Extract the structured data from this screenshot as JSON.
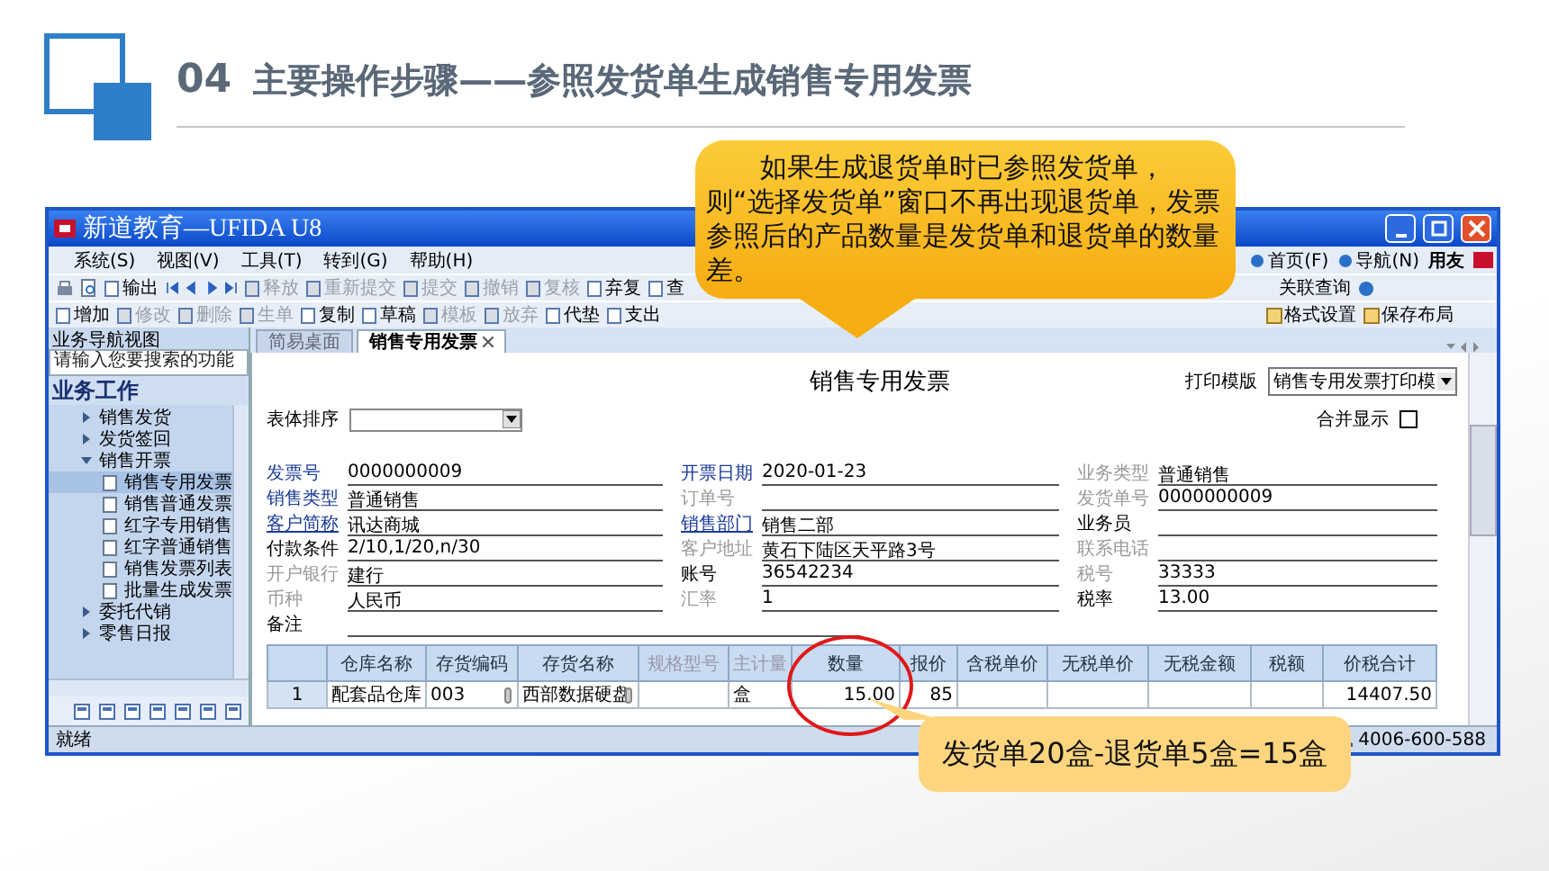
{
  "slide": {
    "section": "04",
    "title": "主要操作步骤——参照发货单生成销售专用发票"
  },
  "window": {
    "title": "新道教育—UFIDA U8",
    "menu": [
      "系统(S)",
      "视图(V)",
      "工具(T)",
      "转到(G)",
      "帮助(H)"
    ],
    "right_links": [
      "首页(F)",
      "导航(N)"
    ],
    "brand": "用友"
  },
  "toolbar_1": [
    {
      "label": "输出",
      "disabled": false
    },
    {
      "label": "释放",
      "disabled": true
    },
    {
      "label": "重新提交",
      "disabled": true
    },
    {
      "label": "提交",
      "disabled": true
    },
    {
      "label": "撤销",
      "disabled": true
    },
    {
      "label": "复核",
      "disabled": true
    },
    {
      "label": "弃复",
      "disabled": false
    },
    {
      "label": "查",
      "disabled": false
    }
  ],
  "toolbar_1_right": [
    {
      "label": "关联查询",
      "disabled": false
    }
  ],
  "toolbar_2": [
    {
      "label": "增加",
      "disabled": false
    },
    {
      "label": "修改",
      "disabled": true
    },
    {
      "label": "删除",
      "disabled": true
    },
    {
      "label": "生单",
      "disabled": true
    },
    {
      "label": "复制",
      "disabled": false
    },
    {
      "label": "草稿",
      "disabled": false
    },
    {
      "label": "模板",
      "disabled": true
    },
    {
      "label": "放弃",
      "disabled": true
    },
    {
      "label": "代垫",
      "disabled": false
    },
    {
      "label": "支出",
      "disabled": false
    }
  ],
  "toolbar_2_right": [
    {
      "label": "格式设置",
      "disabled": false
    },
    {
      "label": "保存布局",
      "disabled": false
    }
  ],
  "sidebar": {
    "title": "业务导航视图",
    "search_placeholder": "请输入您要搜索的功能",
    "section": "业务工作",
    "items": [
      {
        "label": "销售发货",
        "expanded": false,
        "selected": false
      },
      {
        "label": "发货签回",
        "expanded": false,
        "selected": false
      },
      {
        "label": "销售开票",
        "expanded": true,
        "selected": false,
        "children": [
          {
            "label": "销售专用发票",
            "selected": true
          },
          {
            "label": "销售普通发票",
            "selected": false
          },
          {
            "label": "红字专用销售",
            "selected": false
          },
          {
            "label": "红字普通销售",
            "selected": false
          },
          {
            "label": "销售发票列表",
            "selected": false
          },
          {
            "label": "批量生成发票",
            "selected": false
          }
        ]
      },
      {
        "label": "委托代销",
        "expanded": false,
        "selected": false
      },
      {
        "label": "零售日报",
        "expanded": false,
        "selected": false
      }
    ]
  },
  "tabs": [
    {
      "label": "简易桌面",
      "selected": false
    },
    {
      "label": "销售专用发票",
      "selected": true
    }
  ],
  "form": {
    "title": "销售专用发票",
    "print_template": {
      "label": "打印模版",
      "value": "销售专用发票打印模"
    },
    "merge_display": {
      "label": "合并显示",
      "checked": false
    },
    "sort": {
      "label": "表体排序"
    },
    "fields": [
      [
        {
          "label": "发票号",
          "kind": "required",
          "value": "0000000009"
        },
        {
          "label": "销售类型",
          "kind": "required",
          "value": "普通销售"
        },
        {
          "label": "客户简称",
          "kind": "link",
          "value": "讯达商城"
        },
        {
          "label": "付款条件",
          "kind": "normal",
          "value": "2/10,1/20,n/30"
        },
        {
          "label": "开户银行",
          "kind": "disabled",
          "value": "建行"
        },
        {
          "label": "币种",
          "kind": "disabled",
          "value": "人民币"
        }
      ],
      [
        {
          "label": "开票日期",
          "kind": "required",
          "value": "2020-01-23"
        },
        {
          "label": "订单号",
          "kind": "disabled"
        },
        {
          "label": "销售部门",
          "kind": "link",
          "value": "销售二部"
        },
        {
          "label": "客户地址",
          "kind": "disabled",
          "value": "黄石下陆区天平路3号"
        },
        {
          "label": "账号",
          "kind": "normal",
          "value": "36542234"
        },
        {
          "label": "汇率",
          "kind": "disabled",
          "value": "1"
        }
      ],
      [
        {
          "label": "业务类型",
          "kind": "disabled",
          "value": "普通销售"
        },
        {
          "label": "发货单号",
          "kind": "disabled",
          "value": "0000000009"
        },
        {
          "label": "业务员",
          "kind": "normal"
        },
        {
          "label": "联系电话",
          "kind": "disabled"
        },
        {
          "label": "税号",
          "kind": "disabled",
          "value": "33333"
        },
        {
          "label": "税率",
          "kind": "normal",
          "value": "13.00"
        }
      ]
    ],
    "remark": {
      "label": "备注"
    }
  },
  "table": {
    "columns": [
      {
        "label": "仓库名称",
        "disabled": false
      },
      {
        "label": "存货编码",
        "disabled": false,
        "lookup": true
      },
      {
        "label": "存货名称",
        "disabled": false,
        "lookup": true
      },
      {
        "label": "规格型号",
        "disabled": true
      },
      {
        "label": "主计量",
        "disabled": true
      },
      {
        "label": "数量",
        "disabled": false,
        "circled": true
      },
      {
        "label": "报价",
        "disabled": false
      },
      {
        "label": "含税单价",
        "disabled": false
      },
      {
        "label": "无税单价",
        "disabled": false
      },
      {
        "label": "无税金额",
        "disabled": false
      },
      {
        "label": "税额",
        "disabled": false
      },
      {
        "label": "价税合计",
        "disabled": false
      }
    ],
    "rows": [
      {
        "number": "1",
        "cells": [
          "配套品仓库",
          "003",
          "西部数据硬盘",
          null,
          "盒",
          "15.00",
          "85",
          null,
          null,
          null,
          null,
          "14407.50"
        ]
      }
    ]
  },
  "status_bar": {
    "text": "就绪",
    "phone": "4006-600-588"
  },
  "callouts": [
    {
      "kind": "top",
      "text": "如果生成退货单时已参照发货单，则“选择发货单”窗口不再出现退货单，发票参照后的产品数量是发货单和退货单的数量差。"
    },
    {
      "kind": "bottom",
      "text": "发货单20盒-退货单5盒=15盒"
    }
  ]
}
